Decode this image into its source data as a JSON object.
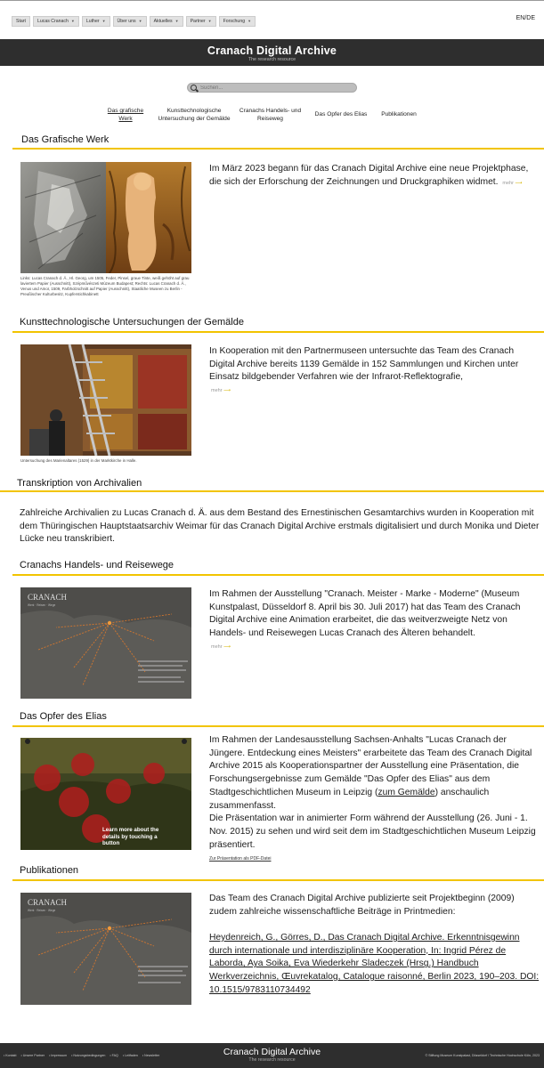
{
  "nav": {
    "items": [
      {
        "label": "Start",
        "chevron": false
      },
      {
        "label": "Lucas Cranach",
        "chevron": true
      },
      {
        "label": "Luther",
        "chevron": true
      },
      {
        "label": "Über uns",
        "chevron": true
      },
      {
        "label": "Aktuelles",
        "chevron": true
      },
      {
        "label": "Partner",
        "chevron": true
      },
      {
        "label": "Forschung",
        "chevron": true
      }
    ],
    "lang": "EN/DE"
  },
  "hero": {
    "title": "Cranach Digital Archive",
    "subtitle": "The research resource"
  },
  "search": {
    "placeholder": "Suchen..."
  },
  "subnav": {
    "items": [
      {
        "label": "Das grafische Werk"
      },
      {
        "label": "Kunsttechnologische Untersuchung der Gemälde"
      },
      {
        "label": "Cranachs Handels- und Reiseweg"
      },
      {
        "label": "Das Opfer des Elias"
      },
      {
        "label": "Publikationen"
      }
    ]
  },
  "sections": {
    "grafisch": {
      "title": "Das Grafische Werk",
      "text": "Im März 2023 begann für das Cranach Digital Archive eine neue Projektphase, die sich der Erforschung der Zeichnungen und Druckgraphiken widmet.",
      "more": "mehr",
      "caption": "Links: Lucas Cranach d. Ä., Hl. Georg, um 1505, Feder, Pinsel, graue Tinte, weiß gehöht auf grau laviertem Papier (Ausschnitt), Szépművészeti Múzeum Budapest; Rechts: Lucas Cranach d. Ä., Venus und Amor, 1509, Farbholzschnitt auf Papier (Ausschnitt), Staatliche Museen zu Berlin - Preußischer Kulturbesitz, Kupferstichkabinett"
    },
    "technologie": {
      "title": "Kunsttechnologische Untersuchungen der Gemälde",
      "text": "In Kooperation mit den Partnermuseen untersuchte das Team des Cranach Digital Archive bereits 1139 Gemälde in 152 Sammlungen und Kirchen unter Einsatz bildgebender Verfahren wie der Infrarot-Reflektografie,",
      "more": "mehr",
      "caption": "Untersuchung des Marienaltares (1529) in der Marktkirche in Halle."
    },
    "archivalien": {
      "title": "Transkription von Archivalien",
      "text": "Zahlreiche Archivalien zu Lucas Cranach d. Ä. aus dem Bestand des Ernestinischen Gesamtarchivs wurden in Kooperation mit dem Thüringischen Hauptstaatsarchiv Weimar für das Cranach Digital Archive erstmals digitalisiert und durch Monika und Dieter Lücke neu transkribiert."
    },
    "reisewege": {
      "title": "Cranachs Handels- und Reisewege",
      "text": "Im Rahmen der Ausstellung \"Cranach. Meister - Marke - Moderne\" (Museum Kunstpalast, Düsseldorf 8. April bis 30. Juli 2017) hat das Team des Cranach Digital Archive eine Animation erarbeitet, die das weitverzweigte Netz von Handels- und Reisewegen Lucas Cranach des Älteren behandelt.",
      "more": "mehr",
      "map_logo": "CRANACH",
      "map_sub": "Werk · Reisen · Wege"
    },
    "elias": {
      "title": "Das Opfer des Elias",
      "text_a": "Im Rahmen der Landesausstellung Sachsen-Anhalts \"Lucas Cranach der Jüngere. Entdeckung eines Meisters\" erarbeitete das Team des Cranach Digital Archive 2015 als Kooperationspartner der Ausstellung eine Präsentation, die Forschungsergebnisse zum Gemälde \"Das Opfer des Elias\" aus dem Stadtgeschichtlichen Museum in Leipzig (",
      "link": "zum Gemälde",
      "text_b": ") anschaulich zusammenfasst.",
      "text_c": "Die Präsentation war in animierter Form während der Ausstellung (26. Juni - 1. Nov. 2015) zu sehen und wird seit dem im Stadtgeschichtlichen Museum Leipzig präsentiert.",
      "pdf": "Zur Präsentation als PDF-Datei",
      "overlay": "Learn more about the details by touching a button"
    },
    "publikationen": {
      "title": "Publikationen",
      "text": "Das Team des Cranach Digital Archive publizierte seit Projektbeginn (2009) zudem zahlreiche wissenschaftliche Beiträge in Printmedien:",
      "citation": "Heydenreich, G., Görres, D., Das Cranach Digital Archive. Erkenntnisgewinn durch internationale und interdisziplinäre Kooperation, In: Ingrid Pérez de Laborda, Aya Soika, Eva Wiederkehr Sladeczek (Hrsg.) Handbuch Werkverzeichnis, Œuvrekatalog, Catalogue raisonné, Berlin 2023, 190–203. DOI: 10.1515/9783110734492",
      "map_logo": "CRANACH",
      "map_sub": "Werk · Reisen · Wege"
    }
  },
  "footer": {
    "links": [
      "Kontakt",
      "Unsere Partner",
      "Impressum",
      "Nutzungsbedingungen",
      "FAQ",
      "Leitfaden",
      "Newsletter"
    ],
    "title": "Cranach Digital Archive",
    "subtitle": "The research resource",
    "copyright": "© Stiftung Museum Kunstpalast, Düsseldorf / Technische Hochschule Köln, 2023"
  },
  "colors": {
    "accent": "#f2c400",
    "dark": "#2e2e2e"
  }
}
